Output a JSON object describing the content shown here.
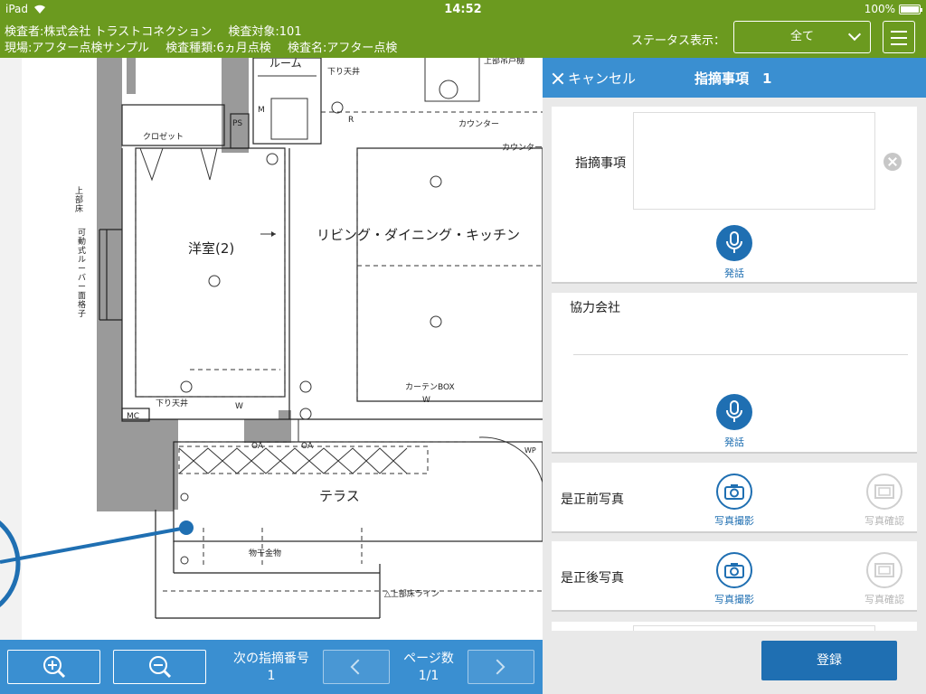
{
  "statusbar": {
    "device": "iPad",
    "time": "14:52",
    "battery": "100%"
  },
  "header": {
    "inspector": "検査者:株式会社 トラストコネクション",
    "target": "検査対象:101",
    "site": "現場:アフター点検サンプル",
    "type": "検査種類:6ヵ月点検",
    "name": "検査名:アフター点検",
    "status_label": "ステータス表示：",
    "status_value": "全て"
  },
  "plan": {
    "labels": {
      "room": "ルーム",
      "ceiling1": "下り天井",
      "ps": "PS",
      "m": "M",
      "r": "R",
      "closet": "クロゼット",
      "counter1": "カウンター",
      "counter2": "カウンター",
      "upper_cabinet": "上部吊戸棚",
      "upper_floor": "上部床",
      "louver": "可動式ルーバー面格子",
      "western": "洋室(2)",
      "ldk": "リビング・ダイニング・キッチン",
      "ceiling2": "下り天井",
      "w1": "W",
      "w2": "W",
      "mc": "MC",
      "curtain": "カーテンBOX",
      "oa1": "OA",
      "oa2": "OA",
      "wp": "WP",
      "terrace": "テラス",
      "drying": "物干金物",
      "floor_line": "△上部床ライン"
    }
  },
  "bottombar": {
    "next_label": "次の指摘番号",
    "next_value": "1",
    "page_label": "ページ数",
    "page_value": "1/1"
  },
  "panel": {
    "cancel": "キャンセル",
    "title": "指摘事項　1",
    "issue_label": "指摘事項",
    "issue_value": "",
    "speak1": "発話",
    "partner_label": "協力会社",
    "partner_value": "",
    "speak2": "発話",
    "before_label": "是正前写真",
    "after_label": "是正後写真",
    "take_photo": "写真撮影",
    "confirm_photo": "写真確認",
    "register": "登録"
  },
  "colors": {
    "green": "#6b9a1f",
    "blue": "#3a8fd1",
    "dark_blue": "#1f6fb2"
  }
}
